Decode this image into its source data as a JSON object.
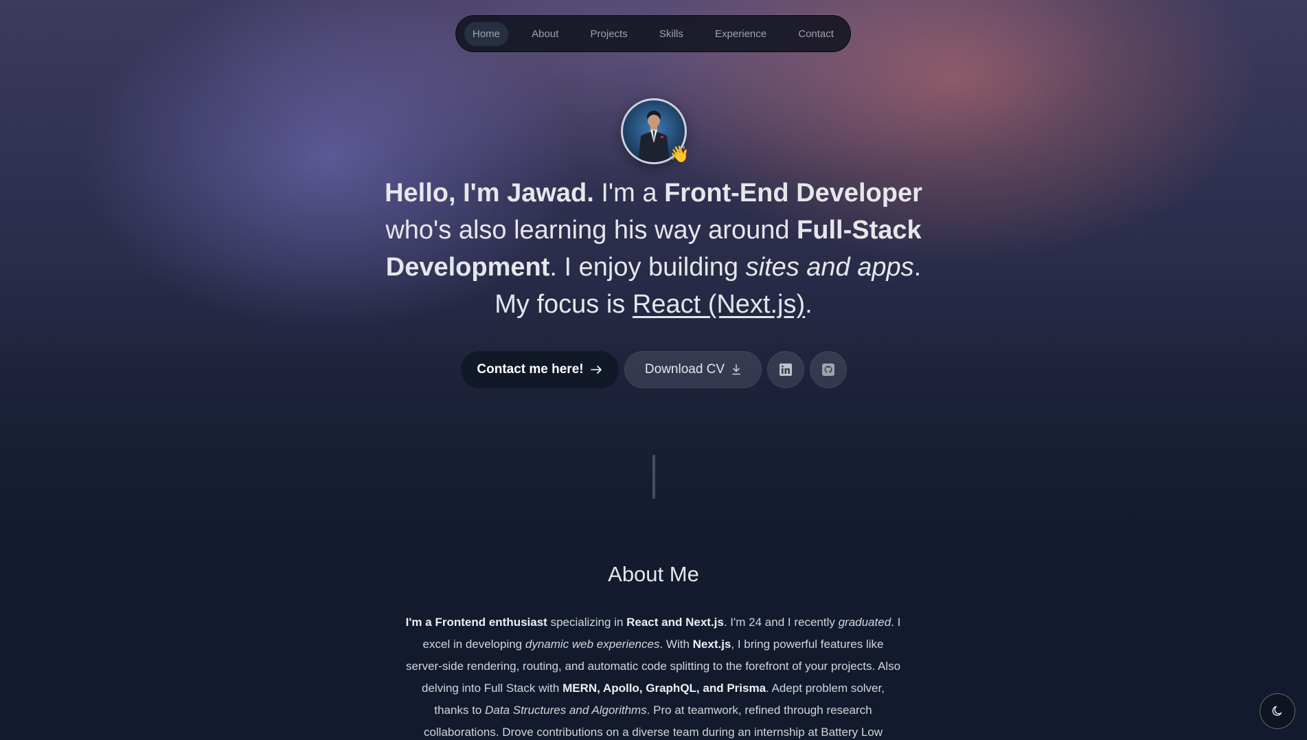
{
  "nav": {
    "items": [
      {
        "label": "Home",
        "active": true
      },
      {
        "label": "About",
        "active": false
      },
      {
        "label": "Projects",
        "active": false
      },
      {
        "label": "Skills",
        "active": false
      },
      {
        "label": "Experience",
        "active": false
      },
      {
        "label": "Contact",
        "active": false
      }
    ]
  },
  "hero": {
    "avatar_emoji": "👋",
    "greeting": "Hello, I'm Jawad.",
    "t1": " I'm a ",
    "role": "Front-End Developer",
    "t2": " who's also learning his way around ",
    "learning": "Full-Stack Development",
    "t3": ". I enjoy building ",
    "building": "sites and apps",
    "t4": ". My focus is ",
    "focus": "React (Next.js)",
    "t5": "."
  },
  "buttons": {
    "contact_label": "Contact me here!",
    "contact_icon": "arrow-right-icon",
    "cv_label": "Download CV",
    "cv_icon": "download-icon",
    "linkedin_icon": "linkedin-icon",
    "github_icon": "github-icon"
  },
  "about": {
    "title": "About Me",
    "s1": "I'm a Frontend enthusiast",
    "s2": " specializing in ",
    "s3": "React and Next.js",
    "s4": ". I'm 24 and I recently ",
    "s5": "graduated",
    "s6": ". I excel in developing ",
    "s7": "dynamic web experiences",
    "s8": ". With ",
    "s9": "Next.js",
    "s10": ", I bring powerful features like server-side rendering, routing, and automatic code splitting to the forefront of your projects. Also delving into Full Stack with ",
    "s11": "MERN, Apollo, GraphQL, and Prisma",
    "s12": ". Adept problem solver, thanks to ",
    "s13": "Data Structures and Algorithms",
    "s14": ". Pro at teamwork, refined through research collaborations. Drove contributions on a diverse team during an internship at Battery Low"
  },
  "theme_toggle": {
    "icon": "moon-icon"
  },
  "colors": {
    "primary_button": "#111827",
    "page_background": "#141a2e",
    "text": "#e5e7eb"
  }
}
